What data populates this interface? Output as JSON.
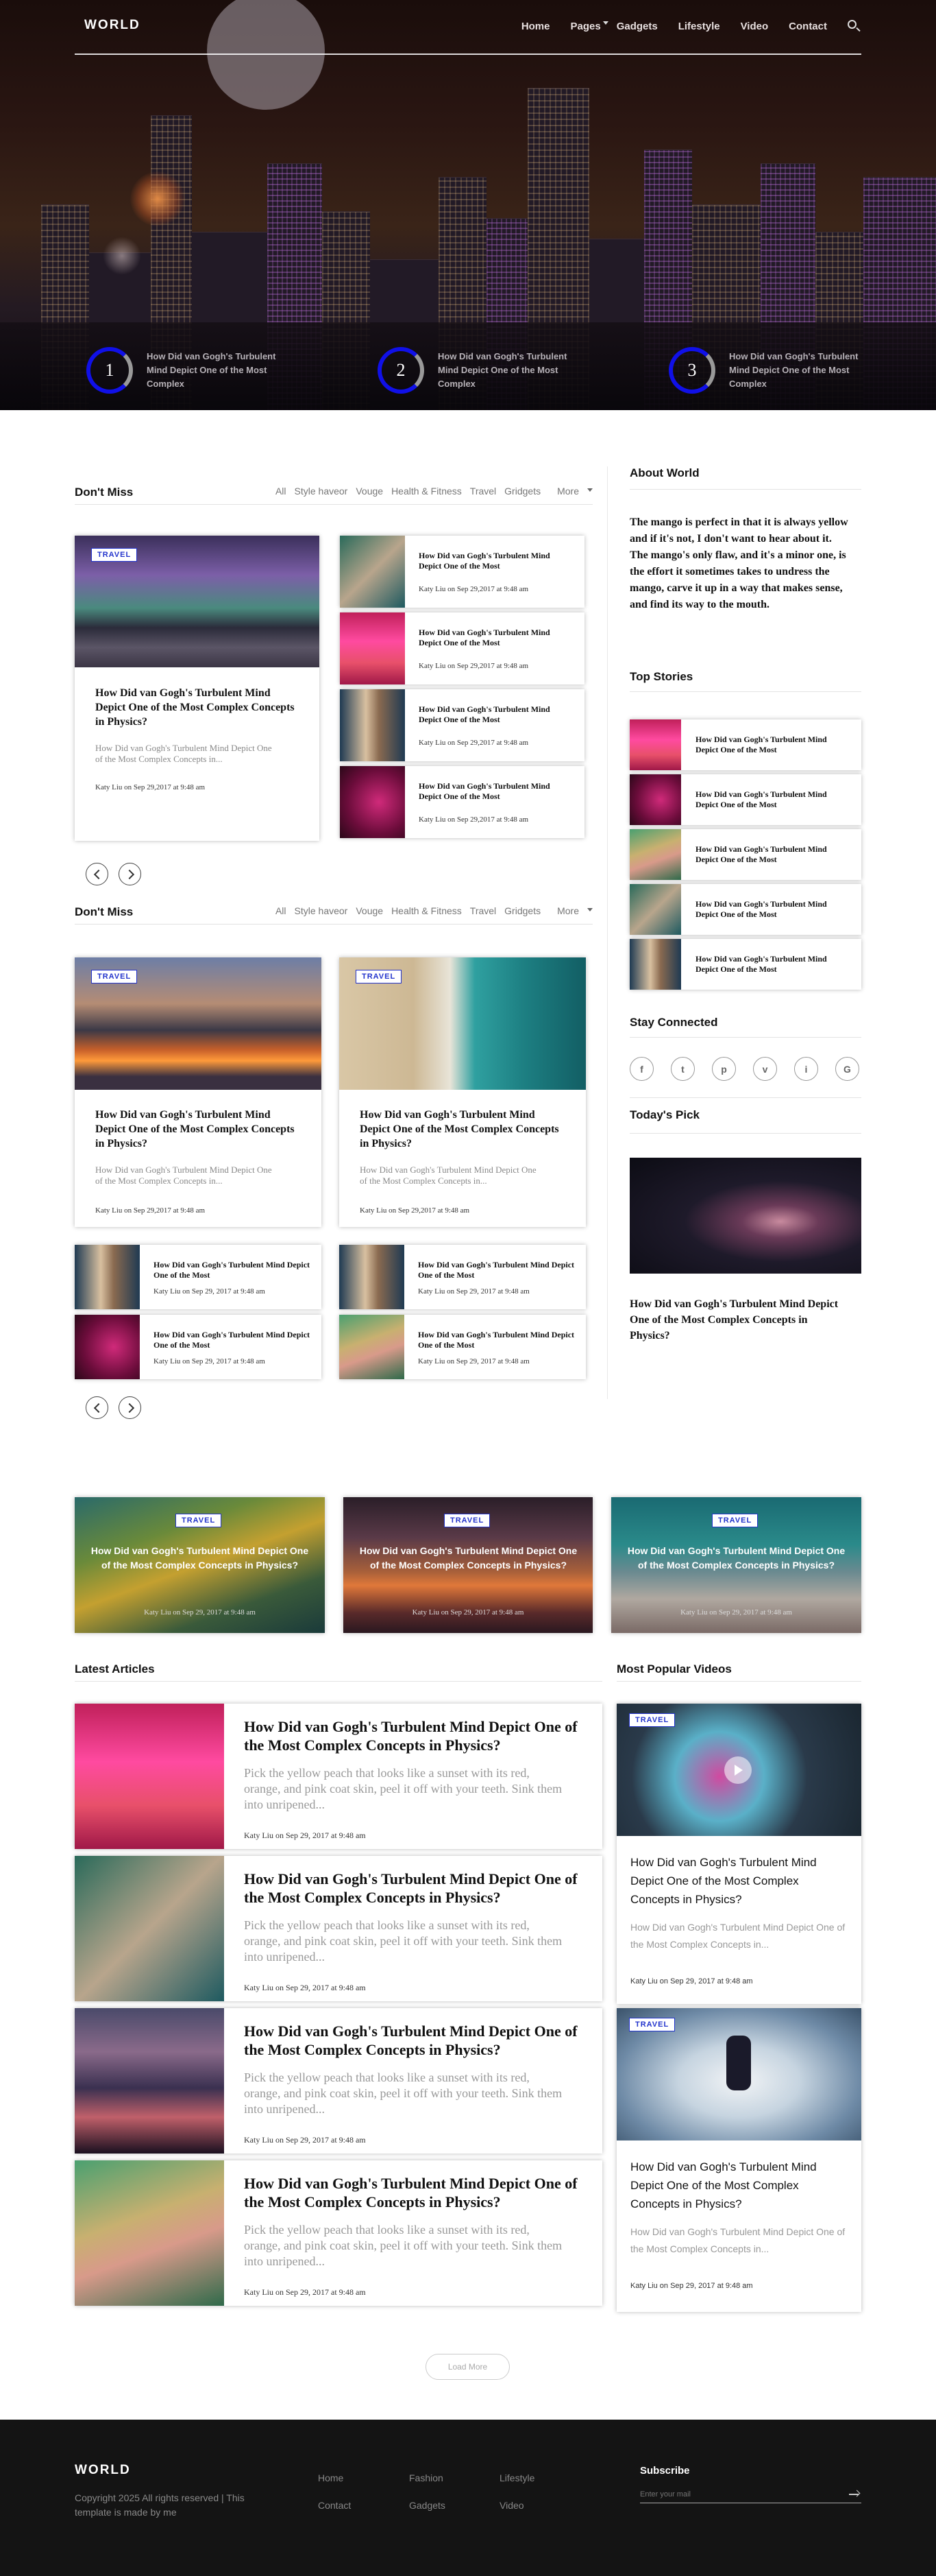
{
  "nav": {
    "logo": "WORLD",
    "items": [
      "Home",
      "Pages",
      "Gadgets",
      "Lifestyle",
      "Video",
      "Contact"
    ]
  },
  "hero": {
    "slides": [
      {
        "num": "1",
        "title": "How Did van Gogh's Turbulent Mind Depict One of the Most Complex"
      },
      {
        "num": "2",
        "title": "How Did van Gogh's Turbulent Mind Depict One of the Most Complex"
      },
      {
        "num": "3",
        "title": "How Did van Gogh's Turbulent Mind Depict One of the Most Complex"
      }
    ]
  },
  "categories": [
    "All",
    "Style haveor",
    "Vouge",
    "Health & Fitness",
    "Travel",
    "Gridgets",
    "More"
  ],
  "dont_miss_1": {
    "heading": "Don't Miss",
    "feature": {
      "tag": "TRAVEL",
      "title": "How Did van Gogh's Turbulent Mind Depict One of the Most Complex Concepts in Physics?",
      "desc": "How Did van Gogh's Turbulent Mind Depict One of the Most Complex Concepts in...",
      "meta": "Katy Liu on Sep 29,2017 at 9:48 am"
    },
    "list": [
      {
        "title": "How Did van Gogh's Turbulent Mind Depict One of the Most",
        "meta": "Katy Liu on Sep 29,2017 at 9:48 am"
      },
      {
        "title": "How Did van Gogh's Turbulent Mind Depict One of the Most",
        "meta": "Katy Liu on Sep 29,2017 at 9:48 am"
      },
      {
        "title": "How Did van Gogh's Turbulent Mind Depict One of the Most",
        "meta": "Katy Liu on Sep 29,2017 at 9:48 am"
      },
      {
        "title": "How Did van Gogh's Turbulent Mind Depict One of the Most",
        "meta": "Katy Liu on Sep 29,2017 at 9:48 am"
      }
    ]
  },
  "dont_miss_2": {
    "heading": "Don't Miss",
    "features": [
      {
        "tag": "TRAVEL",
        "title": "How Did van Gogh's Turbulent Mind Depict One of the Most Complex Concepts in Physics?",
        "desc": "How Did van Gogh's Turbulent Mind Depict One of the Most Complex Concepts in...",
        "meta": "Katy Liu on Sep 29,2017 at 9:48 am"
      },
      {
        "tag": "TRAVEL",
        "title": "How Did van Gogh's Turbulent Mind Depict One of the Most Complex Concepts in Physics?",
        "desc": "How Did van Gogh's Turbulent Mind Depict One of the Most Complex Concepts in...",
        "meta": "Katy Liu on Sep 29,2017 at 9:48 am"
      }
    ],
    "list": [
      {
        "title": "How Did van Gogh's Turbulent Mind Depict One of the Most",
        "meta": "Katy Liu on Sep 29, 2017 at 9:48 am"
      },
      {
        "title": "How Did van Gogh's Turbulent Mind Depict One of the Most",
        "meta": "Katy Liu on Sep 29, 2017 at 9:48 am"
      },
      {
        "title": "How Did van Gogh's Turbulent Mind Depict One of the Most",
        "meta": "Katy Liu on Sep 29, 2017 at 9:48 am"
      },
      {
        "title": "How Did van Gogh's Turbulent Mind Depict One of the Most",
        "meta": "Katy Liu on Sep 29, 2017 at 9:48 am"
      }
    ]
  },
  "sidebar": {
    "about_heading": "About World",
    "about_text": "The mango is perfect in that it is always yellow and if it's not, I don't want to hear about it. The mango's only flaw, and it's a minor one, is the effort it sometimes takes to undress the mango, carve it up in a way that makes sense, and find its way to the mouth.",
    "top_heading": "Top Stories",
    "top_stories": [
      {
        "title": "How Did van Gogh's Turbulent Mind Depict One of the Most"
      },
      {
        "title": "How Did van Gogh's Turbulent Mind Depict One of the Most"
      },
      {
        "title": "How Did van Gogh's Turbulent Mind Depict One of the Most"
      },
      {
        "title": "How Did van Gogh's Turbulent Mind Depict One of the Most"
      },
      {
        "title": "How Did van Gogh's Turbulent Mind Depict One of the Most"
      }
    ],
    "stay_heading": "Stay Connected",
    "socials": [
      "f",
      "t",
      "p",
      "v",
      "i",
      "G"
    ],
    "pick_heading": "Today's Pick",
    "pick_title": "How Did van Gogh's Turbulent Mind Depict One of the Most Complex Concepts in Physics?"
  },
  "banners": [
    {
      "tag": "TRAVEL",
      "title": "How Did van Gogh's Turbulent Mind Depict One of the Most Complex Concepts in Physics?",
      "meta": "Katy Liu on Sep 29, 2017 at 9:48 am"
    },
    {
      "tag": "TRAVEL",
      "title": "How Did van Gogh's Turbulent Mind Depict One of the Most Complex Concepts in Physics?",
      "meta": "Katy Liu on Sep 29, 2017 at 9:48 am"
    },
    {
      "tag": "TRAVEL",
      "title": "How Did van Gogh's Turbulent Mind Depict One of the Most Complex Concepts in Physics?",
      "meta": "Katy Liu on Sep 29, 2017 at 9:48 am"
    }
  ],
  "latest": {
    "heading": "Latest Articles",
    "items": [
      {
        "title": "How Did van Gogh's Turbulent Mind Depict One of the Most Complex Concepts in Physics?",
        "desc": "Pick the yellow peach that looks like a sunset with its red, orange, and pink coat skin, peel it off with your teeth. Sink them into unripened...",
        "meta": "Katy Liu on Sep 29, 2017 at 9:48 am"
      },
      {
        "title": "How Did van Gogh's Turbulent Mind Depict One of the Most Complex Concepts in Physics?",
        "desc": "Pick the yellow peach that looks like a sunset with its red, orange, and pink coat skin, peel it off with your teeth. Sink them into unripened...",
        "meta": "Katy Liu on Sep 29, 2017 at 9:48 am"
      },
      {
        "title": "How Did van Gogh's Turbulent Mind Depict One of the Most Complex Concepts in Physics?",
        "desc": "Pick the yellow peach that looks like a sunset with its red, orange, and pink coat skin, peel it off with your teeth. Sink them into unripened...",
        "meta": "Katy Liu on Sep 29, 2017 at 9:48 am"
      },
      {
        "title": "How Did van Gogh's Turbulent Mind Depict One of the Most Complex Concepts in Physics?",
        "desc": "Pick the yellow peach that looks like a sunset with its red, orange, and pink coat skin, peel it off with your teeth. Sink them into unripened...",
        "meta": "Katy Liu on Sep 29, 2017 at 9:48 am"
      }
    ],
    "load_more": "Load More"
  },
  "videos": {
    "heading": "Most Popular Videos",
    "items": [
      {
        "tag": "TRAVEL",
        "title": "How Did van Gogh's Turbulent Mind Depict One of the Most Complex Concepts in Physics?",
        "desc": "How Did van Gogh's Turbulent Mind Depict One of the Most Complex Concepts in...",
        "meta": "Katy Liu on Sep 29, 2017 at 9:48 am"
      },
      {
        "tag": "TRAVEL",
        "title": "How Did van Gogh's Turbulent Mind Depict One of the Most Complex Concepts in Physics?",
        "desc": "How Did van Gogh's Turbulent Mind Depict One of the Most Complex Concepts in...",
        "meta": "Katy Liu on Sep 29, 2017 at 9:48 am"
      }
    ]
  },
  "footer": {
    "logo": "WORLD",
    "copyright": "Copyright 2025 All rights reserved | This template is made by me",
    "links": [
      "Home",
      "Fashion",
      "Lifestyle",
      "Contact",
      "Gadgets",
      "Video"
    ],
    "subscribe_heading": "Subscribe",
    "email_placeholder": "Enter your mail"
  },
  "colors": {
    "accent": "#1010e8",
    "tag_text": "#2233cc",
    "footer_bg": "#141414"
  }
}
